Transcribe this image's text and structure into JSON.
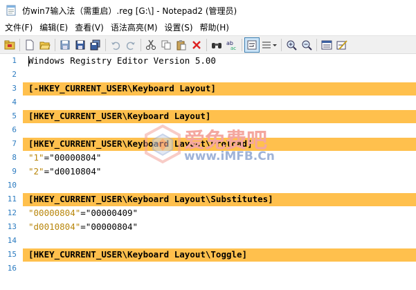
{
  "window": {
    "title": "仿win7输入法（需重启）.reg [G:\\] - Notepad2 (管理员)"
  },
  "menu": [
    {
      "label": "文件(F)"
    },
    {
      "label": "编辑(E)"
    },
    {
      "label": "查看(V)"
    },
    {
      "label": "语法高亮(M)"
    },
    {
      "label": "设置(S)"
    },
    {
      "label": "帮助(H)"
    }
  ],
  "toolbar": {
    "icons": [
      "open-folder-icon",
      "new-file-icon",
      "open-file-icon",
      "save-icon",
      "save-as-icon",
      "save-copy-icon",
      "undo-icon",
      "redo-icon",
      "cut-icon",
      "copy-icon",
      "paste-icon",
      "delete-icon",
      "find-icon",
      "replace-icon",
      "word-wrap-icon",
      "list-icon",
      "zoom-in-icon",
      "zoom-out-icon",
      "scheme-icon",
      "settings-icon"
    ],
    "pressed": "word-wrap-icon"
  },
  "editor": {
    "lines": [
      {
        "n": "1",
        "type": "plain",
        "text": "Windows Registry Editor Version 5.00"
      },
      {
        "n": "2",
        "type": "empty",
        "text": ""
      },
      {
        "n": "3",
        "type": "section",
        "text": "[-HKEY_CURRENT_USER\\Keyboard Layout]"
      },
      {
        "n": "4",
        "type": "empty",
        "text": ""
      },
      {
        "n": "5",
        "type": "section",
        "text": "[HKEY_CURRENT_USER\\Keyboard Layout]"
      },
      {
        "n": "6",
        "type": "empty",
        "text": ""
      },
      {
        "n": "7",
        "type": "section",
        "text": "[HKEY_CURRENT_USER\\Keyboard Layout\\Preload]"
      },
      {
        "n": "8",
        "type": "kv",
        "key": "\"1\"",
        "eq": "=",
        "value": "\"00000804\""
      },
      {
        "n": "9",
        "type": "kv",
        "key": "\"2\"",
        "eq": "=",
        "value": "\"d0010804\""
      },
      {
        "n": "10",
        "type": "empty",
        "text": ""
      },
      {
        "n": "11",
        "type": "section",
        "text": "[HKEY_CURRENT_USER\\Keyboard Layout\\Substitutes]"
      },
      {
        "n": "12",
        "type": "kv",
        "key": "\"00000804\"",
        "eq": "=",
        "value": "\"00000409\""
      },
      {
        "n": "13",
        "type": "kv",
        "key": "\"d0010804\"",
        "eq": "=",
        "value": "\"00000804\""
      },
      {
        "n": "14",
        "type": "empty",
        "text": ""
      },
      {
        "n": "15",
        "type": "section",
        "text": "[HKEY_CURRENT_USER\\Keyboard Layout\\Toggle]"
      },
      {
        "n": "16",
        "type": "empty",
        "text": ""
      }
    ]
  },
  "watermark": {
    "text": "爱免费吧",
    "url": "www.iMFB.Cn"
  },
  "colors": {
    "section_highlight": "#ffc04d",
    "line_number": "#2b7bc0",
    "string": "#b8860b",
    "toolbar_bg": "#f0f0f0"
  }
}
